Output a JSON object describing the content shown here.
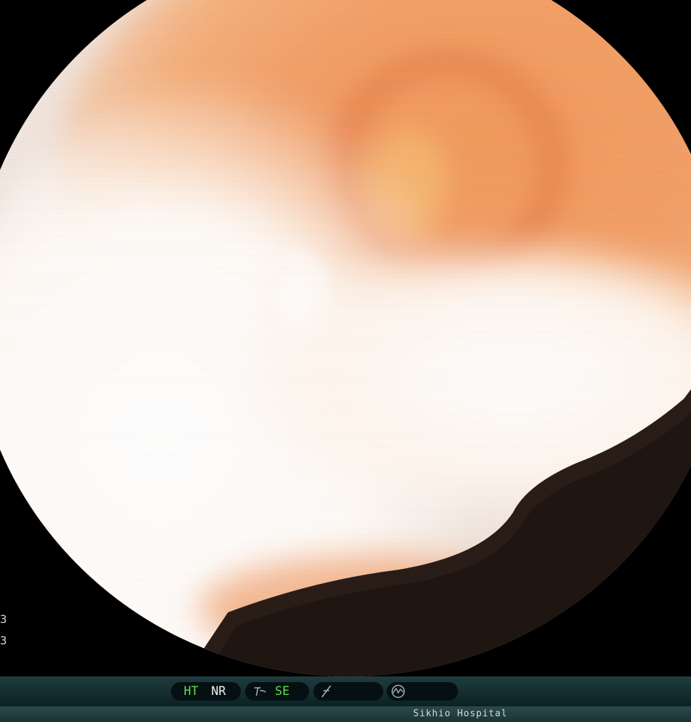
{
  "status_bar": {
    "mode_group": {
      "ht_label": "HT",
      "nr_label": "NR"
    },
    "enhance_group": {
      "se_label": "SE",
      "icon": "structure-enhance-icon"
    },
    "gamma_group": {
      "icon": "gamma-curve-icon"
    },
    "iris_group": {
      "icon": "iris-meter-icon"
    }
  },
  "footer": {
    "institution": "Sikhio Hospital"
  },
  "side_marks": [
    "3",
    "3"
  ],
  "top_mark": "",
  "colors": {
    "active_label": "#59e04b",
    "inactive_label": "#f0f0f0",
    "bar_background": "#0c2224"
  }
}
